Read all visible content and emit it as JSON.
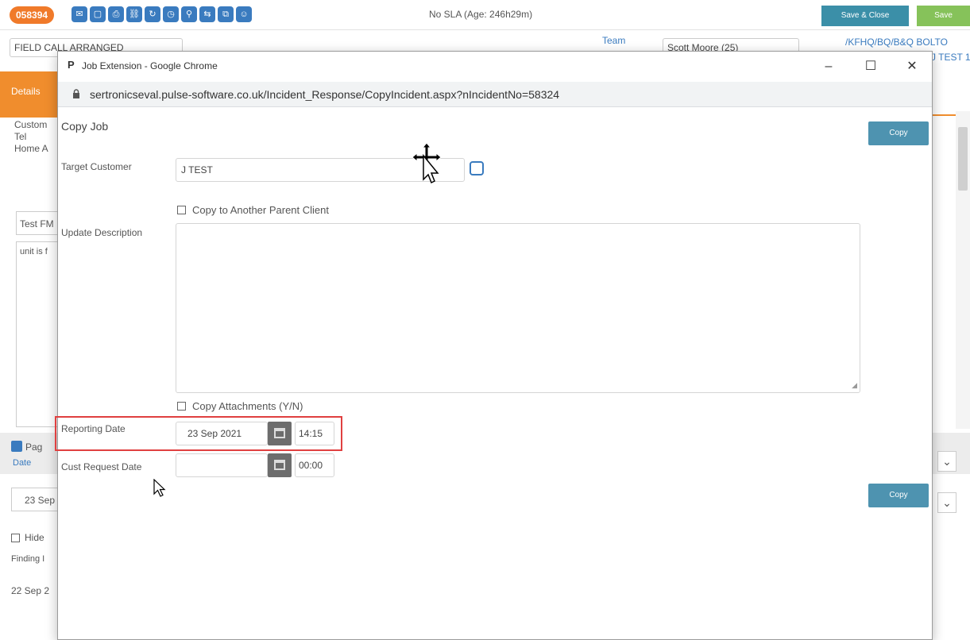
{
  "app": {
    "job_number": "058394",
    "sla_text": "No SLA (Age: 246h29m)",
    "save_close_label": "Save & Close",
    "save_label": "Save",
    "toolbar_icons": [
      "envelope-icon",
      "box-icon",
      "print-icon",
      "link-icon",
      "refresh-icon",
      "clock-icon",
      "pin-icon",
      "share-icon",
      "copy-icon",
      "user-icon"
    ],
    "status_value": "FIELD CALL ARRANGED",
    "team_label": "Team",
    "engineer_value": "Scott Moore (25)",
    "site_link": "/KFHQ/BQ/B&Q BOLTO",
    "site_link2": "J TEST 1",
    "details_tab": "Details",
    "customer_label": "Custom",
    "tel_label": "Tel",
    "home_label": "Home A",
    "test_field": "Test FM",
    "unit_text": "unit is f",
    "page_label": "Pag",
    "date_label": "Date",
    "date_value": "23 Sep",
    "hide_label": "Hide",
    "finding_label": "Finding I",
    "finding_date": "22 Sep 2"
  },
  "window": {
    "title": "Job Extension - Google Chrome",
    "url": "sertronicseval.pulse-software.co.uk/Incident_Response/CopyIncident.aspx?nIncidentNo=58324"
  },
  "form": {
    "heading": "Copy Job",
    "copy_top_label": "Copy",
    "copy_bottom_label": "Copy",
    "target_customer_label": "Target Customer",
    "target_customer_value": "J TEST",
    "copy_parent_label": "Copy to Another Parent Client",
    "update_description_label": "Update Description",
    "copy_attachments_label": "Copy Attachments (Y/N)",
    "reporting_date_label": "Reporting Date",
    "reporting_date_value": "23 Sep 2021",
    "reporting_time_value": "14:15",
    "cust_request_label": "Cust Request Date",
    "cust_request_value": "",
    "cust_request_time": "00:00"
  },
  "colors": {
    "accent_orange": "#f08d2d",
    "copy_button": "#4e93b0",
    "highlight": "#e04040"
  }
}
